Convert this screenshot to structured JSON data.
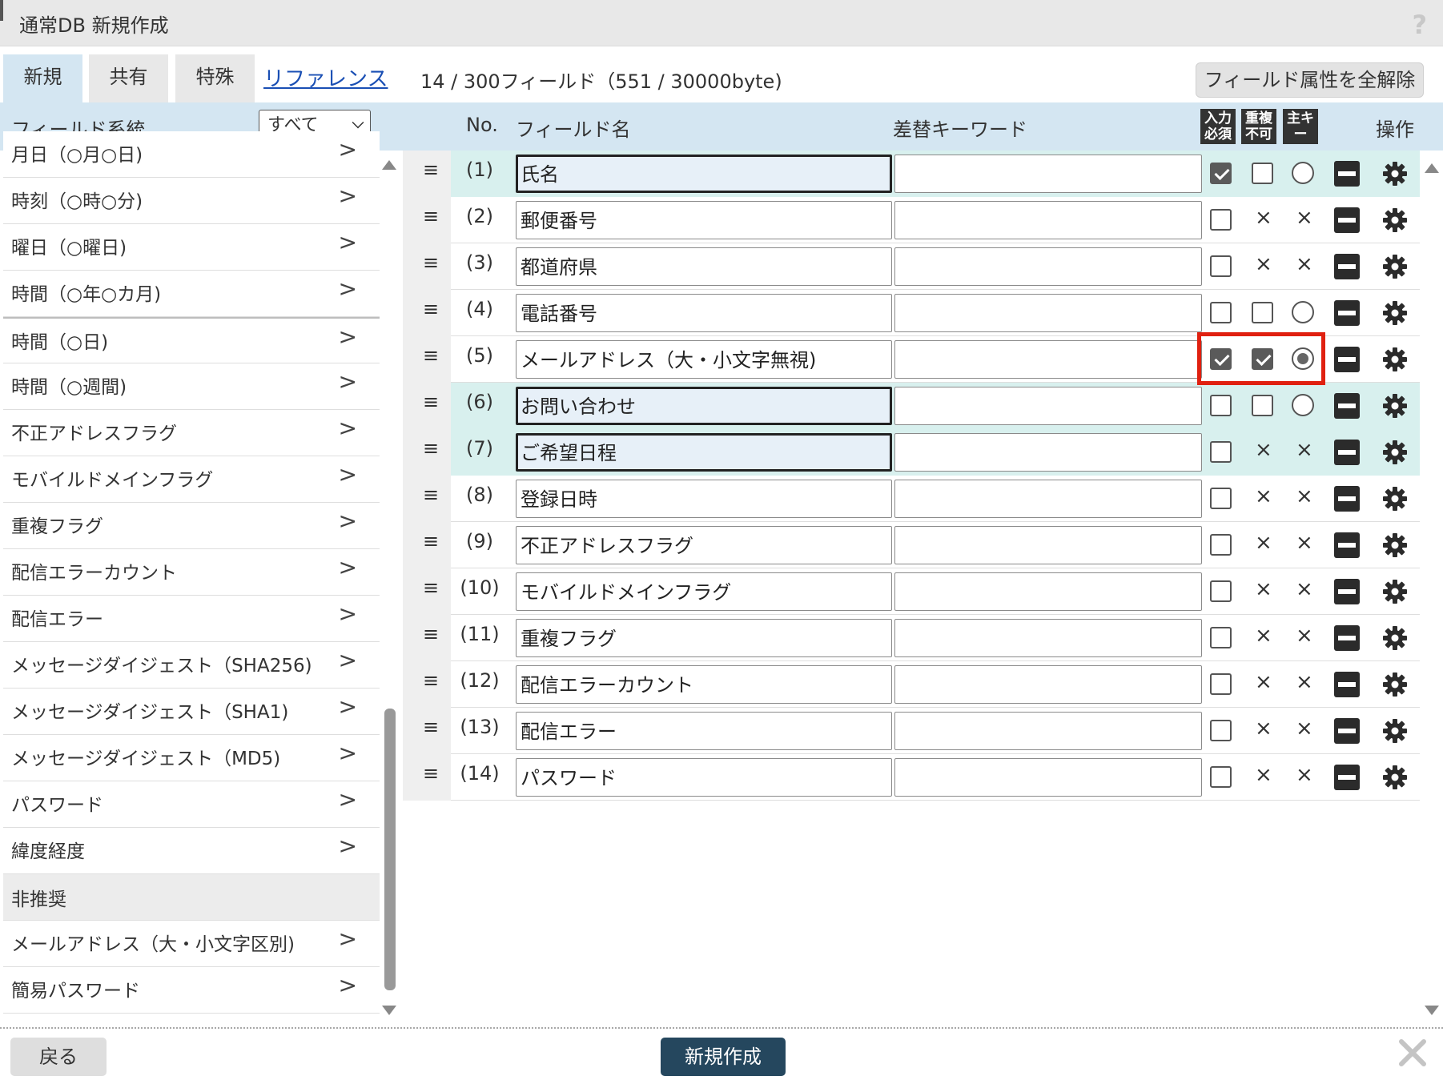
{
  "dialog": {
    "title": "通常DB 新規作成",
    "help_label": "?"
  },
  "tabs": [
    {
      "label": "新規",
      "active": true
    },
    {
      "label": "共有",
      "active": false
    },
    {
      "label": "特殊",
      "active": false
    }
  ],
  "reference_link": "リファレンス",
  "field_count": "14 / 300フィールド（551 / 30000byte)",
  "clear_button": "フィールド属性を全解除",
  "left_panel": {
    "header": "フィールド系統",
    "filter_value": "すべて",
    "items": [
      "月日（○月○日)",
      "時刻（○時○分)",
      "曜日（○曜日)",
      "時間（○年○カ月)",
      "時間（○日)",
      "時間（○週間)",
      "不正アドレスフラグ",
      "モバイルドメインフラグ",
      "重複フラグ",
      "配信エラーカウント",
      "配信エラー",
      "メッセージダイジェスト（SHA256)",
      "メッセージダイジェスト（SHA1)",
      "メッセージダイジェスト（MD5)",
      "パスワード",
      "緯度経度"
    ],
    "arrow_label": ">",
    "deprecated_section": "非推奨",
    "deprecated_items": [
      "メールアドレス（大・小文字区別)",
      "簡易パスワード"
    ]
  },
  "table": {
    "headers": {
      "no": "No.",
      "name": "フィールド名",
      "keyword": "差替キーワード",
      "required_icon": "入力必須",
      "unique_icon": "重複不可",
      "primary_key_icon": "主キー",
      "operations": "操作"
    },
    "handle_label": "≡",
    "rows": [
      {
        "no": "(1)",
        "name": "氏名",
        "keyword": "",
        "required": true,
        "unique": "unchecked",
        "primary": "unchecked",
        "highlighted": true
      },
      {
        "no": "(2)",
        "name": "郵便番号",
        "keyword": "",
        "required": false,
        "unique": "disabled",
        "primary": "disabled",
        "highlighted": false
      },
      {
        "no": "(3)",
        "name": "都道府県",
        "keyword": "",
        "required": false,
        "unique": "disabled",
        "primary": "disabled",
        "highlighted": false
      },
      {
        "no": "(4)",
        "name": "電話番号",
        "keyword": "",
        "required": false,
        "unique": "unchecked",
        "primary": "unchecked",
        "highlighted": false
      },
      {
        "no": "(5)",
        "name": "メールアドレス（大・小文字無視)",
        "keyword": "",
        "required": true,
        "unique": "checked",
        "primary": "checked",
        "highlighted": false
      },
      {
        "no": "(6)",
        "name": "お問い合わせ",
        "keyword": "",
        "required": false,
        "unique": "unchecked",
        "primary": "unchecked",
        "highlighted": true
      },
      {
        "no": "(7)",
        "name": "ご希望日程",
        "keyword": "",
        "required": false,
        "unique": "disabled",
        "primary": "disabled",
        "highlighted": true
      },
      {
        "no": "(8)",
        "name": "登録日時",
        "keyword": "",
        "required": false,
        "unique": "disabled",
        "primary": "disabled",
        "highlighted": false
      },
      {
        "no": "(9)",
        "name": "不正アドレスフラグ",
        "keyword": "",
        "required": false,
        "unique": "disabled",
        "primary": "disabled",
        "highlighted": false
      },
      {
        "no": "(10)",
        "name": "モバイルドメインフラグ",
        "keyword": "",
        "required": false,
        "unique": "disabled",
        "primary": "disabled",
        "highlighted": false
      },
      {
        "no": "(11)",
        "name": "重複フラグ",
        "keyword": "",
        "required": false,
        "unique": "disabled",
        "primary": "disabled",
        "highlighted": false
      },
      {
        "no": "(12)",
        "name": "配信エラーカウント",
        "keyword": "",
        "required": false,
        "unique": "disabled",
        "primary": "disabled",
        "highlighted": false
      },
      {
        "no": "(13)",
        "name": "配信エラー",
        "keyword": "",
        "required": false,
        "unique": "disabled",
        "primary": "disabled",
        "highlighted": false
      },
      {
        "no": "(14)",
        "name": "パスワード",
        "keyword": "",
        "required": false,
        "unique": "disabled",
        "primary": "disabled",
        "highlighted": false
      }
    ],
    "disabled_mark": "×"
  },
  "footer": {
    "back_button": "戻る",
    "create_button": "新規作成"
  },
  "colors": {
    "header_bg": "#d4e6f2",
    "highlight_row": "#d8f0ee",
    "primary_button": "#25475e",
    "annotation_box": "#e02010"
  },
  "icons": {
    "row_delete": "minus-icon",
    "row_settings": "gear-icon",
    "drag_handle": "drag-handle-icon",
    "close": "close-icon"
  }
}
